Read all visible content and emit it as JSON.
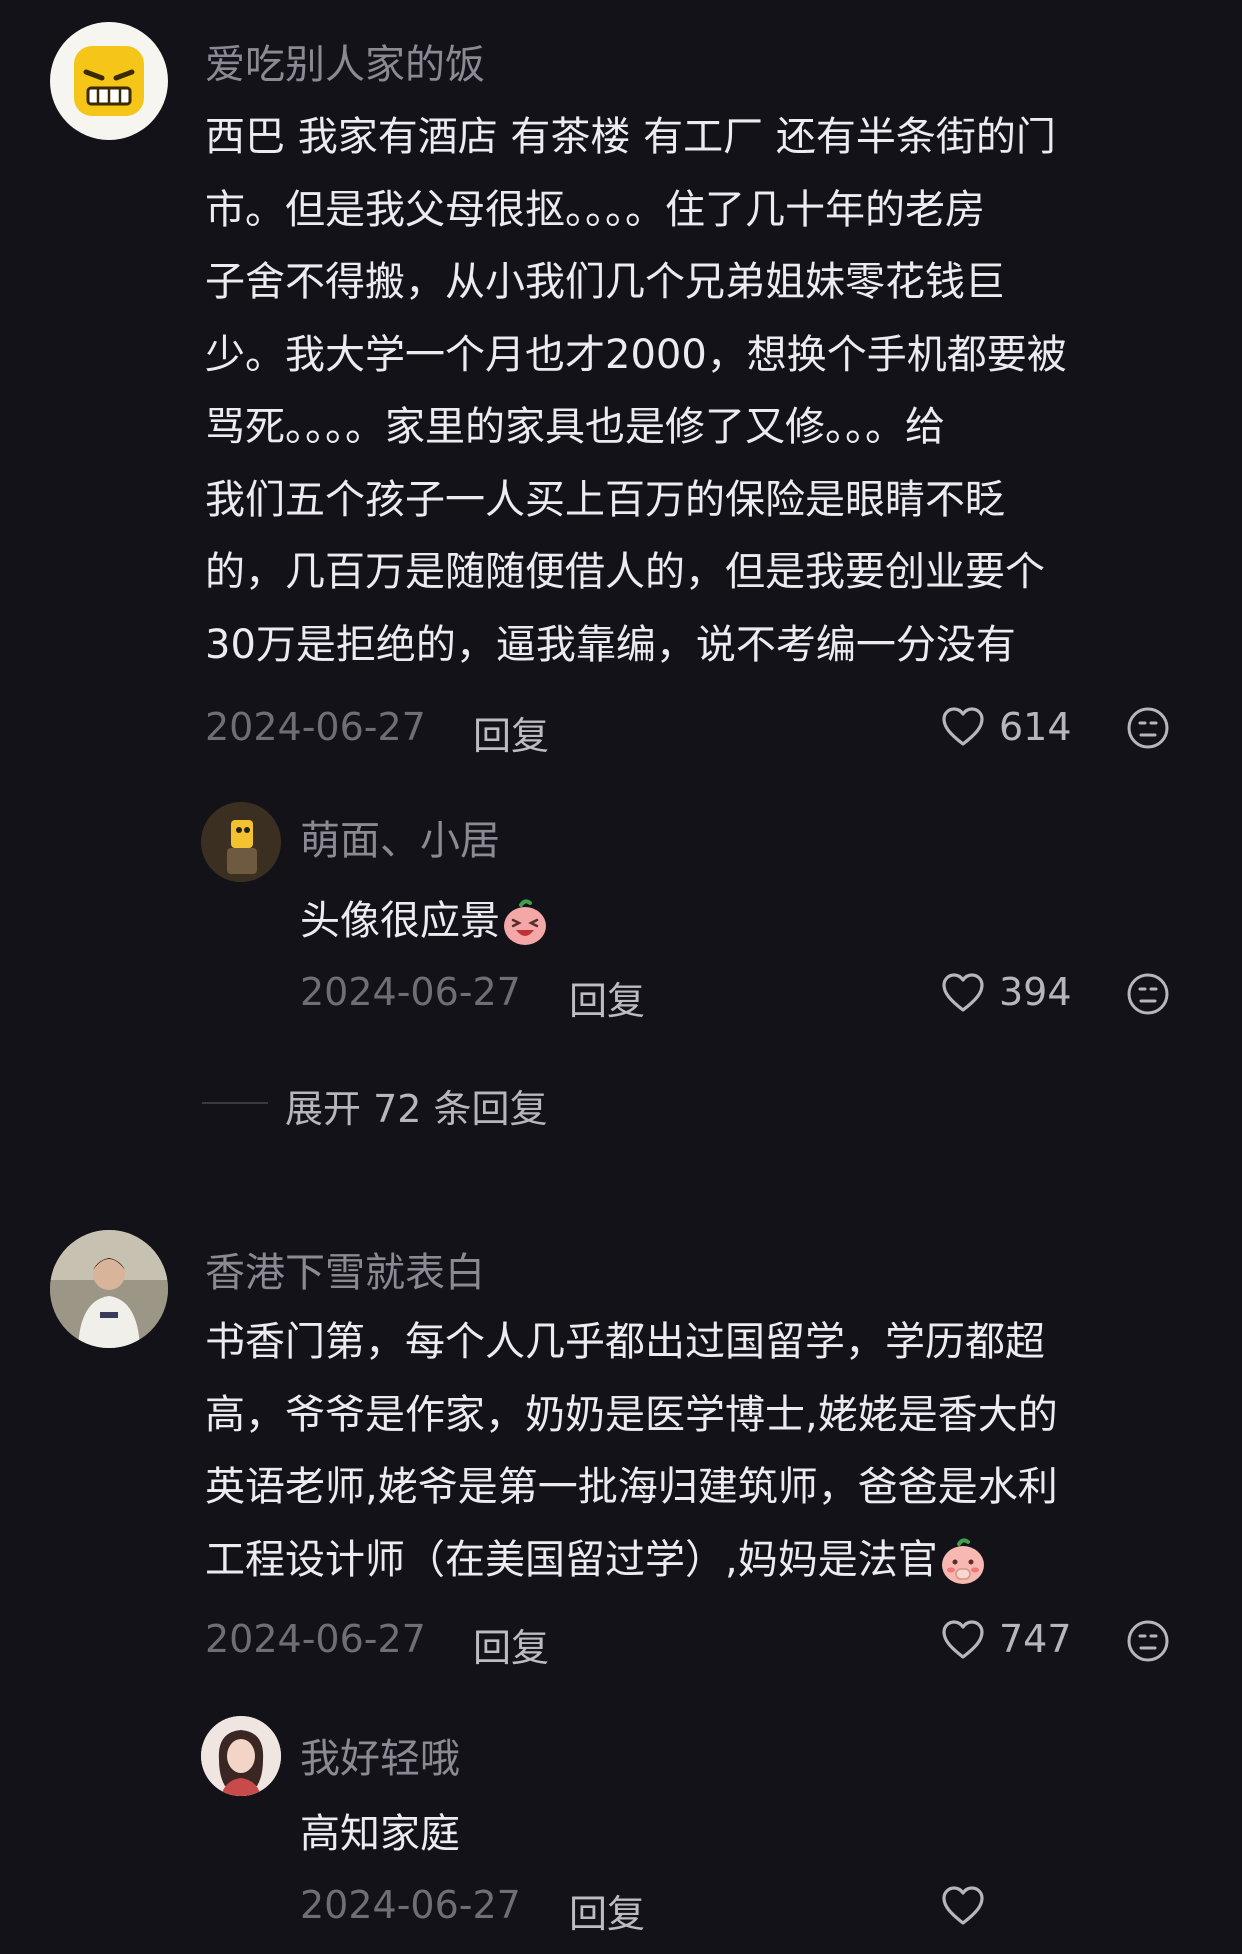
{
  "comments": [
    {
      "username": "爱吃别人家的饭",
      "content_lines": [
        "西巴 我家有酒店 有茶楼 有工厂 还有半条街的门",
        "市。但是我父母很抠。。。。住了几十年的老房",
        "子舍不得搬，从小我们几个兄弟姐妹零花钱巨",
        "少。我大学一个月也才2000，想换个手机都要被",
        "骂死。。。。家里的家具也是修了又修。。。给",
        "我们五个孩子一人买上百万的保险是眼睛不眨",
        "的，几百万是随随便借人的，但是我要创业要个",
        "30万是拒绝的，逼我靠编，说不考编一分没有"
      ],
      "date": "2024-06-27",
      "reply_label": "回复",
      "likes": "614",
      "avatar_icon": "angry-face-icon",
      "reply": {
        "username": "萌面、小居",
        "content": "头像很应景",
        "emoji_icon": "laughing-peach-emoji-icon",
        "date": "2024-06-27",
        "reply_label": "回复",
        "likes": "394"
      },
      "expand_label": "展开 72 条回复"
    },
    {
      "username": "香港下雪就表白",
      "content_lines": [
        "书香门第，每个人几乎都出过国留学，学历都超",
        "高，爷爷是作家，奶奶是医学博士,姥姥是香大的",
        "英语老师,姥爷是第一批海归建筑师，爸爸是水利",
        "工程设计师（在美国留过学）,妈妈是法官"
      ],
      "content_emoji_icon": "shy-peach-emoji-icon",
      "date": "2024-06-27",
      "reply_label": "回复",
      "likes": "747",
      "reply": {
        "username": "我好轻哦",
        "content": "高知家庭",
        "date": "2024-06-27",
        "reply_label": "回复"
      }
    }
  ],
  "colors": {
    "background": "#121218",
    "text_primary": "#ecebf0",
    "text_secondary": "#8b8a93",
    "text_meta": "#6f6e77"
  }
}
